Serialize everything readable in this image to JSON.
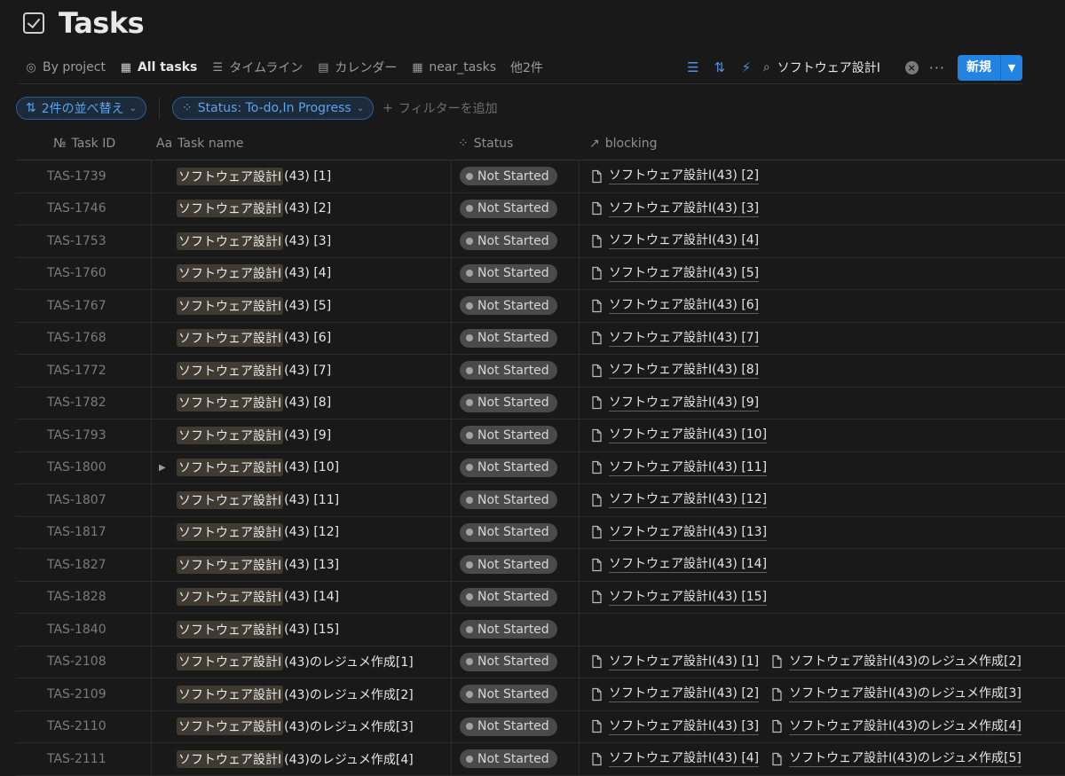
{
  "page": {
    "title": "Tasks"
  },
  "views": [
    {
      "label": "By project",
      "icon": "target-icon"
    },
    {
      "label": "All tasks",
      "icon": "table-icon",
      "active": true
    },
    {
      "label": "タイムライン",
      "icon": "timeline-icon"
    },
    {
      "label": "カレンダー",
      "icon": "calendar-icon"
    },
    {
      "label": "near_tasks",
      "icon": "table-icon"
    },
    {
      "label": "他2件",
      "icon": ""
    }
  ],
  "toolbar": {
    "search_value": "ソフトウェア設計I",
    "new_label": "新規"
  },
  "filters": {
    "sort_label": "2件の並べ替え",
    "status_filter_label": "Status: To-do,In Progress",
    "add_filter_label": "フィルターを追加"
  },
  "columns": {
    "id": "Task ID",
    "id_prefix": "№",
    "name": "Task name",
    "name_prefix": "Aa",
    "status": "Status",
    "blocking": "blocking"
  },
  "colors": {
    "accent": "#2383e2",
    "background": "#191919",
    "status_pill": "#4a4a4a"
  },
  "rows": [
    {
      "id": "TAS-1739",
      "hl": "ソフトウェア設計I",
      "rest": "(43) [1]",
      "status": "Not Started",
      "blocking": [
        "ソフトウェア設計I(43) [2]"
      ]
    },
    {
      "id": "TAS-1746",
      "hl": "ソフトウェア設計I",
      "rest": "(43) [2]",
      "status": "Not Started",
      "blocking": [
        "ソフトウェア設計I(43) [3]"
      ]
    },
    {
      "id": "TAS-1753",
      "hl": "ソフトウェア設計I",
      "rest": "(43) [3]",
      "status": "Not Started",
      "blocking": [
        "ソフトウェア設計I(43) [4]"
      ]
    },
    {
      "id": "TAS-1760",
      "hl": "ソフトウェア設計I",
      "rest": "(43) [4]",
      "status": "Not Started",
      "blocking": [
        "ソフトウェア設計I(43) [5]"
      ]
    },
    {
      "id": "TAS-1767",
      "hl": "ソフトウェア設計I",
      "rest": "(43) [5]",
      "status": "Not Started",
      "blocking": [
        "ソフトウェア設計I(43) [6]"
      ]
    },
    {
      "id": "TAS-1768",
      "hl": "ソフトウェア設計I",
      "rest": "(43) [6]",
      "status": "Not Started",
      "blocking": [
        "ソフトウェア設計I(43) [7]"
      ]
    },
    {
      "id": "TAS-1772",
      "hl": "ソフトウェア設計I",
      "rest": "(43) [7]",
      "status": "Not Started",
      "blocking": [
        "ソフトウェア設計I(43) [8]"
      ]
    },
    {
      "id": "TAS-1782",
      "hl": "ソフトウェア設計I",
      "rest": "(43) [8]",
      "status": "Not Started",
      "blocking": [
        "ソフトウェア設計I(43) [9]"
      ]
    },
    {
      "id": "TAS-1793",
      "hl": "ソフトウェア設計I",
      "rest": "(43) [9]",
      "status": "Not Started",
      "blocking": [
        "ソフトウェア設計I(43) [10]"
      ]
    },
    {
      "id": "TAS-1800",
      "hl": "ソフトウェア設計I",
      "rest": "(43) [10]",
      "status": "Not Started",
      "blocking": [
        "ソフトウェア設計I(43) [11]"
      ],
      "has_children": true
    },
    {
      "id": "TAS-1807",
      "hl": "ソフトウェア設計I",
      "rest": "(43) [11]",
      "status": "Not Started",
      "blocking": [
        "ソフトウェア設計I(43) [12]"
      ]
    },
    {
      "id": "TAS-1817",
      "hl": "ソフトウェア設計I",
      "rest": "(43) [12]",
      "status": "Not Started",
      "blocking": [
        "ソフトウェア設計I(43) [13]"
      ]
    },
    {
      "id": "TAS-1827",
      "hl": "ソフトウェア設計I",
      "rest": "(43) [13]",
      "status": "Not Started",
      "blocking": [
        "ソフトウェア設計I(43) [14]"
      ]
    },
    {
      "id": "TAS-1828",
      "hl": "ソフトウェア設計I",
      "rest": "(43) [14]",
      "status": "Not Started",
      "blocking": [
        "ソフトウェア設計I(43) [15]"
      ]
    },
    {
      "id": "TAS-1840",
      "hl": "ソフトウェア設計I",
      "rest": "(43) [15]",
      "status": "Not Started",
      "blocking": []
    },
    {
      "id": "TAS-2108",
      "hl": "ソフトウェア設計I",
      "rest": "(43)のレジュメ作成[1]",
      "status": "Not Started",
      "blocking": [
        "ソフトウェア設計I(43) [1]",
        "ソフトウェア設計I(43)のレジュメ作成[2]"
      ]
    },
    {
      "id": "TAS-2109",
      "hl": "ソフトウェア設計I",
      "rest": "(43)のレジュメ作成[2]",
      "status": "Not Started",
      "blocking": [
        "ソフトウェア設計I(43) [2]",
        "ソフトウェア設計I(43)のレジュメ作成[3]"
      ]
    },
    {
      "id": "TAS-2110",
      "hl": "ソフトウェア設計I",
      "rest": "(43)のレジュメ作成[3]",
      "status": "Not Started",
      "blocking": [
        "ソフトウェア設計I(43) [3]",
        "ソフトウェア設計I(43)のレジュメ作成[4]"
      ]
    },
    {
      "id": "TAS-2111",
      "hl": "ソフトウェア設計I",
      "rest": "(43)のレジュメ作成[4]",
      "status": "Not Started",
      "blocking": [
        "ソフトウェア設計I(43) [4]",
        "ソフトウェア設計I(43)のレジュメ作成[5]"
      ]
    }
  ]
}
